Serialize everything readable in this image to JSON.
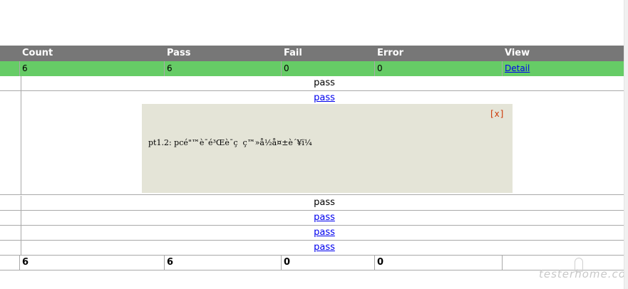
{
  "header": {
    "count_label": "Count",
    "pass_label": "Pass",
    "fail_label": "Fail",
    "error_label": "Error",
    "view_label": "View"
  },
  "summary": {
    "count": "6",
    "pass": "6",
    "fail": "0",
    "error": "0",
    "view_link": "Detail"
  },
  "tests": [
    {
      "status": "pass",
      "is_link": false
    },
    {
      "status": "pass",
      "is_link": true
    },
    {
      "status": "pass",
      "is_link": false
    },
    {
      "status": "pass",
      "is_link": true
    },
    {
      "status": "pass",
      "is_link": true
    },
    {
      "status": "pass",
      "is_link": true
    }
  ],
  "popup": {
    "close_label": "[x]",
    "log_text": "pt1.2: pcé\"™è¯é³Œè¯ç  ç™»å½å¤±è´¥ï¼"
  },
  "totals": {
    "count": "6",
    "pass": "6",
    "fail": "0",
    "error": "0"
  },
  "watermark": "testerhome.com",
  "colors": {
    "header_bg": "#777777",
    "summary_bg": "#66cc66",
    "popup_bg": "#e4e4d7",
    "link": "#0000ee",
    "close": "#cc3300"
  }
}
